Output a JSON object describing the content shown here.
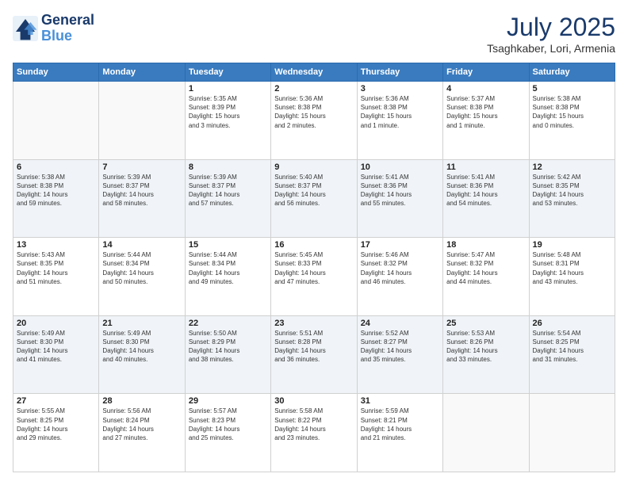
{
  "logo": {
    "line1": "General",
    "line2": "Blue"
  },
  "title": "July 2025",
  "subtitle": "Tsaghkaber, Lori, Armenia",
  "headers": [
    "Sunday",
    "Monday",
    "Tuesday",
    "Wednesday",
    "Thursday",
    "Friday",
    "Saturday"
  ],
  "weeks": [
    [
      {
        "day": "",
        "info": ""
      },
      {
        "day": "",
        "info": ""
      },
      {
        "day": "1",
        "info": "Sunrise: 5:35 AM\nSunset: 8:39 PM\nDaylight: 15 hours\nand 3 minutes."
      },
      {
        "day": "2",
        "info": "Sunrise: 5:36 AM\nSunset: 8:38 PM\nDaylight: 15 hours\nand 2 minutes."
      },
      {
        "day": "3",
        "info": "Sunrise: 5:36 AM\nSunset: 8:38 PM\nDaylight: 15 hours\nand 1 minute."
      },
      {
        "day": "4",
        "info": "Sunrise: 5:37 AM\nSunset: 8:38 PM\nDaylight: 15 hours\nand 1 minute."
      },
      {
        "day": "5",
        "info": "Sunrise: 5:38 AM\nSunset: 8:38 PM\nDaylight: 15 hours\nand 0 minutes."
      }
    ],
    [
      {
        "day": "6",
        "info": "Sunrise: 5:38 AM\nSunset: 8:38 PM\nDaylight: 14 hours\nand 59 minutes."
      },
      {
        "day": "7",
        "info": "Sunrise: 5:39 AM\nSunset: 8:37 PM\nDaylight: 14 hours\nand 58 minutes."
      },
      {
        "day": "8",
        "info": "Sunrise: 5:39 AM\nSunset: 8:37 PM\nDaylight: 14 hours\nand 57 minutes."
      },
      {
        "day": "9",
        "info": "Sunrise: 5:40 AM\nSunset: 8:37 PM\nDaylight: 14 hours\nand 56 minutes."
      },
      {
        "day": "10",
        "info": "Sunrise: 5:41 AM\nSunset: 8:36 PM\nDaylight: 14 hours\nand 55 minutes."
      },
      {
        "day": "11",
        "info": "Sunrise: 5:41 AM\nSunset: 8:36 PM\nDaylight: 14 hours\nand 54 minutes."
      },
      {
        "day": "12",
        "info": "Sunrise: 5:42 AM\nSunset: 8:35 PM\nDaylight: 14 hours\nand 53 minutes."
      }
    ],
    [
      {
        "day": "13",
        "info": "Sunrise: 5:43 AM\nSunset: 8:35 PM\nDaylight: 14 hours\nand 51 minutes."
      },
      {
        "day": "14",
        "info": "Sunrise: 5:44 AM\nSunset: 8:34 PM\nDaylight: 14 hours\nand 50 minutes."
      },
      {
        "day": "15",
        "info": "Sunrise: 5:44 AM\nSunset: 8:34 PM\nDaylight: 14 hours\nand 49 minutes."
      },
      {
        "day": "16",
        "info": "Sunrise: 5:45 AM\nSunset: 8:33 PM\nDaylight: 14 hours\nand 47 minutes."
      },
      {
        "day": "17",
        "info": "Sunrise: 5:46 AM\nSunset: 8:32 PM\nDaylight: 14 hours\nand 46 minutes."
      },
      {
        "day": "18",
        "info": "Sunrise: 5:47 AM\nSunset: 8:32 PM\nDaylight: 14 hours\nand 44 minutes."
      },
      {
        "day": "19",
        "info": "Sunrise: 5:48 AM\nSunset: 8:31 PM\nDaylight: 14 hours\nand 43 minutes."
      }
    ],
    [
      {
        "day": "20",
        "info": "Sunrise: 5:49 AM\nSunset: 8:30 PM\nDaylight: 14 hours\nand 41 minutes."
      },
      {
        "day": "21",
        "info": "Sunrise: 5:49 AM\nSunset: 8:30 PM\nDaylight: 14 hours\nand 40 minutes."
      },
      {
        "day": "22",
        "info": "Sunrise: 5:50 AM\nSunset: 8:29 PM\nDaylight: 14 hours\nand 38 minutes."
      },
      {
        "day": "23",
        "info": "Sunrise: 5:51 AM\nSunset: 8:28 PM\nDaylight: 14 hours\nand 36 minutes."
      },
      {
        "day": "24",
        "info": "Sunrise: 5:52 AM\nSunset: 8:27 PM\nDaylight: 14 hours\nand 35 minutes."
      },
      {
        "day": "25",
        "info": "Sunrise: 5:53 AM\nSunset: 8:26 PM\nDaylight: 14 hours\nand 33 minutes."
      },
      {
        "day": "26",
        "info": "Sunrise: 5:54 AM\nSunset: 8:25 PM\nDaylight: 14 hours\nand 31 minutes."
      }
    ],
    [
      {
        "day": "27",
        "info": "Sunrise: 5:55 AM\nSunset: 8:25 PM\nDaylight: 14 hours\nand 29 minutes."
      },
      {
        "day": "28",
        "info": "Sunrise: 5:56 AM\nSunset: 8:24 PM\nDaylight: 14 hours\nand 27 minutes."
      },
      {
        "day": "29",
        "info": "Sunrise: 5:57 AM\nSunset: 8:23 PM\nDaylight: 14 hours\nand 25 minutes."
      },
      {
        "day": "30",
        "info": "Sunrise: 5:58 AM\nSunset: 8:22 PM\nDaylight: 14 hours\nand 23 minutes."
      },
      {
        "day": "31",
        "info": "Sunrise: 5:59 AM\nSunset: 8:21 PM\nDaylight: 14 hours\nand 21 minutes."
      },
      {
        "day": "",
        "info": ""
      },
      {
        "day": "",
        "info": ""
      }
    ]
  ]
}
